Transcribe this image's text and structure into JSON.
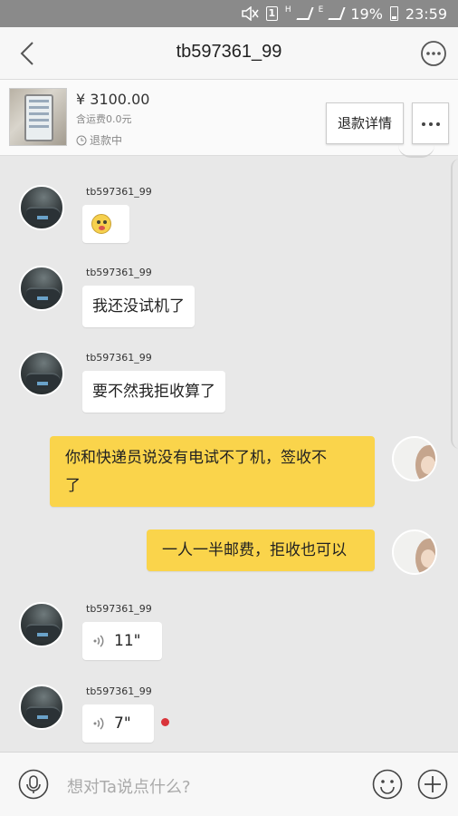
{
  "status_bar": {
    "battery": "19%",
    "time": "23:59",
    "sim_label": "1",
    "net_h": "H",
    "net_e": "E"
  },
  "header": {
    "title": "tb597361_99"
  },
  "order": {
    "price": "¥ 3100.00",
    "shipping": "含运费0.0元",
    "status": "退款中",
    "refund_button": "退款详情"
  },
  "messages": [
    {
      "sender": "tb597361_99",
      "type": "emoji",
      "icon": "surprised-face-emoji"
    },
    {
      "sender": "tb597361_99",
      "type": "text",
      "text": "我还没试机了"
    },
    {
      "sender": "tb597361_99",
      "type": "text",
      "text": "要不然我拒收算了"
    },
    {
      "sender": "me",
      "type": "text",
      "line1": "你和快递员说没有电试不了机，签收不",
      "line2": "了"
    },
    {
      "sender": "me",
      "type": "text",
      "text": "一人一半邮费，拒收也可以"
    },
    {
      "sender": "tb597361_99",
      "type": "voice",
      "duration": "11\""
    },
    {
      "sender": "tb597361_99",
      "type": "voice",
      "duration": "7\"",
      "unread": true
    }
  ],
  "input": {
    "placeholder": "想对Ta说点什么?"
  },
  "colors": {
    "my_bubble": "#fad44b",
    "unread_dot": "#d9343a",
    "chat_bg": "#e8e8e8"
  }
}
